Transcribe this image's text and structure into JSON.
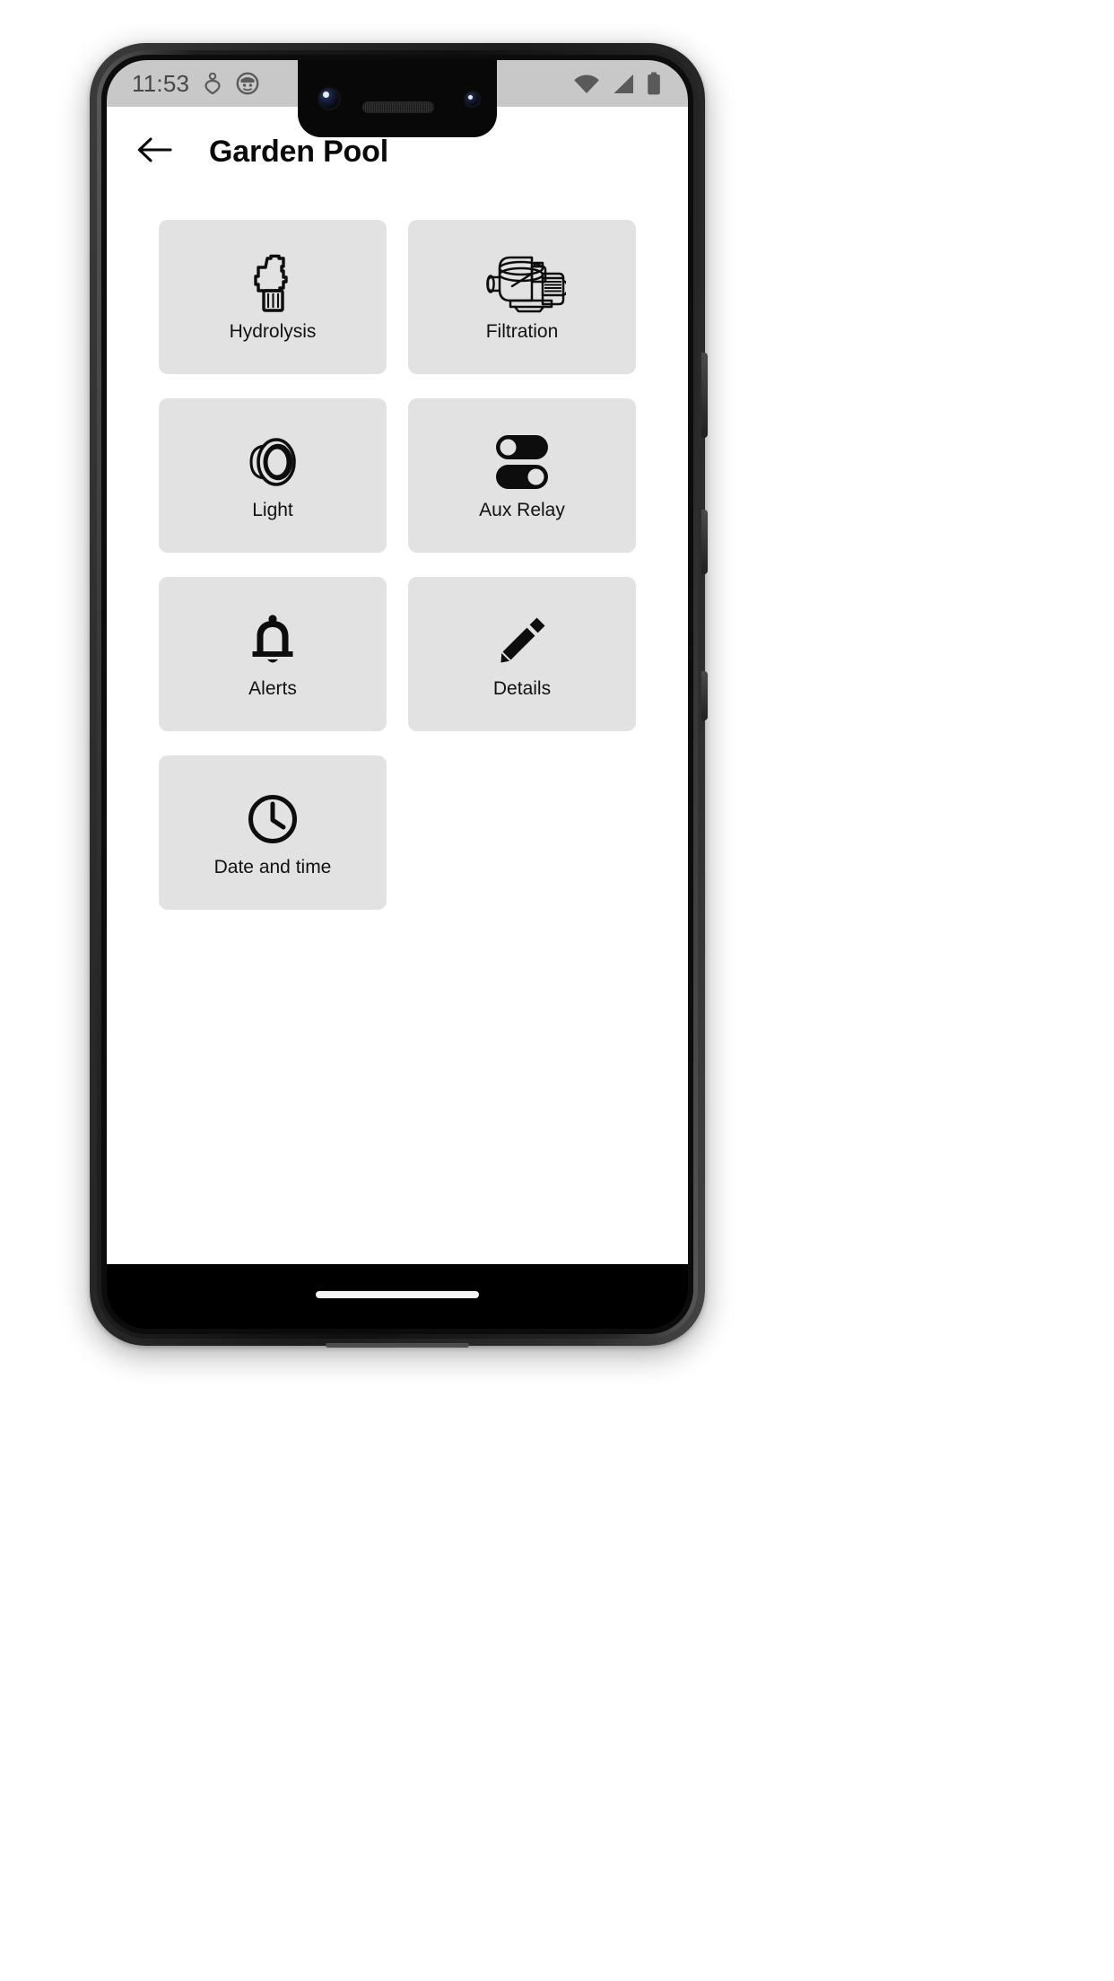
{
  "status_bar": {
    "time": "11:53",
    "left_icons": [
      "location-icon",
      "app-notification-icon"
    ],
    "right_icons": [
      "wifi-icon",
      "cellular-signal-icon",
      "battery-icon"
    ],
    "background_color": "#c8c8c8",
    "icon_color": "#5a5a5a"
  },
  "app_bar": {
    "back_icon": "arrow-left-icon",
    "title": "Garden Pool"
  },
  "theme": {
    "tile_background": "#e2e2e2",
    "tile_icon_color": "#111111",
    "page_background": "#ffffff",
    "nav_background": "#000000"
  },
  "grid": {
    "tiles": [
      {
        "id": "hydrolysis",
        "label": "Hydrolysis",
        "icon": "salt-cell-icon"
      },
      {
        "id": "filtration",
        "label": "Filtration",
        "icon": "pool-pump-icon"
      },
      {
        "id": "light",
        "label": "Light",
        "icon": "pool-spotlight-icon"
      },
      {
        "id": "aux-relay",
        "label": "Aux Relay",
        "icon": "double-toggle-switch-icon"
      },
      {
        "id": "alerts",
        "label": "Alerts",
        "icon": "bell-icon"
      },
      {
        "id": "details",
        "label": "Details",
        "icon": "pencil-icon"
      },
      {
        "id": "date-and-time",
        "label": "Date and time",
        "icon": "clock-icon"
      }
    ]
  },
  "nav_bar": {
    "home_indicator": "home-indicator-pill"
  }
}
